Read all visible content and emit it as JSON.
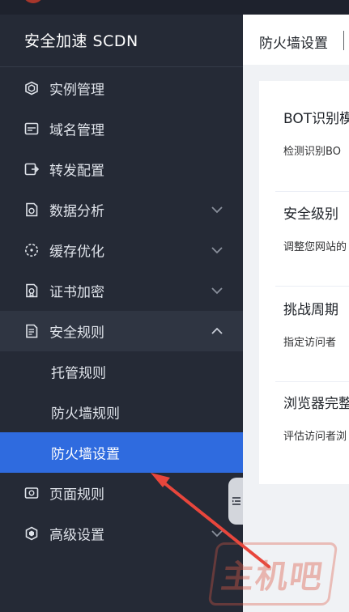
{
  "sidebar": {
    "title": "安全加速 SCDN",
    "items": [
      {
        "label": "实例管理",
        "icon": "cube-icon"
      },
      {
        "label": "域名管理",
        "icon": "domain-icon"
      },
      {
        "label": "转发配置",
        "icon": "forward-icon"
      },
      {
        "label": "数据分析",
        "icon": "analytics-icon",
        "expandable": true
      },
      {
        "label": "缓存优化",
        "icon": "cache-icon",
        "expandable": true
      },
      {
        "label": "证书加密",
        "icon": "certificate-icon",
        "expandable": true
      },
      {
        "label": "安全规则",
        "icon": "security-rules-icon",
        "expandable": true,
        "expanded": true,
        "children": [
          {
            "label": "托管规则"
          },
          {
            "label": "防火墙规则"
          },
          {
            "label": "防火墙设置",
            "active": true
          }
        ]
      },
      {
        "label": "页面规则",
        "icon": "page-rules-icon"
      },
      {
        "label": "高级设置",
        "icon": "shield-icon",
        "expandable": true
      }
    ]
  },
  "tabs": [
    {
      "label": "防火墙设置"
    }
  ],
  "settings": [
    {
      "title": "BOT识别模",
      "desc": "检测识别BO"
    },
    {
      "title": "安全级别",
      "desc": "调整您网站的"
    },
    {
      "title": "挑战周期",
      "desc": "指定访问者"
    },
    {
      "title": "浏览器完整",
      "desc": "评估访问者浏"
    }
  ],
  "watermark": "主机吧",
  "colors": {
    "sidebar_bg": "#252a36",
    "active_bg": "#2f6bdf",
    "annotation_arrow": "#e8463c"
  }
}
